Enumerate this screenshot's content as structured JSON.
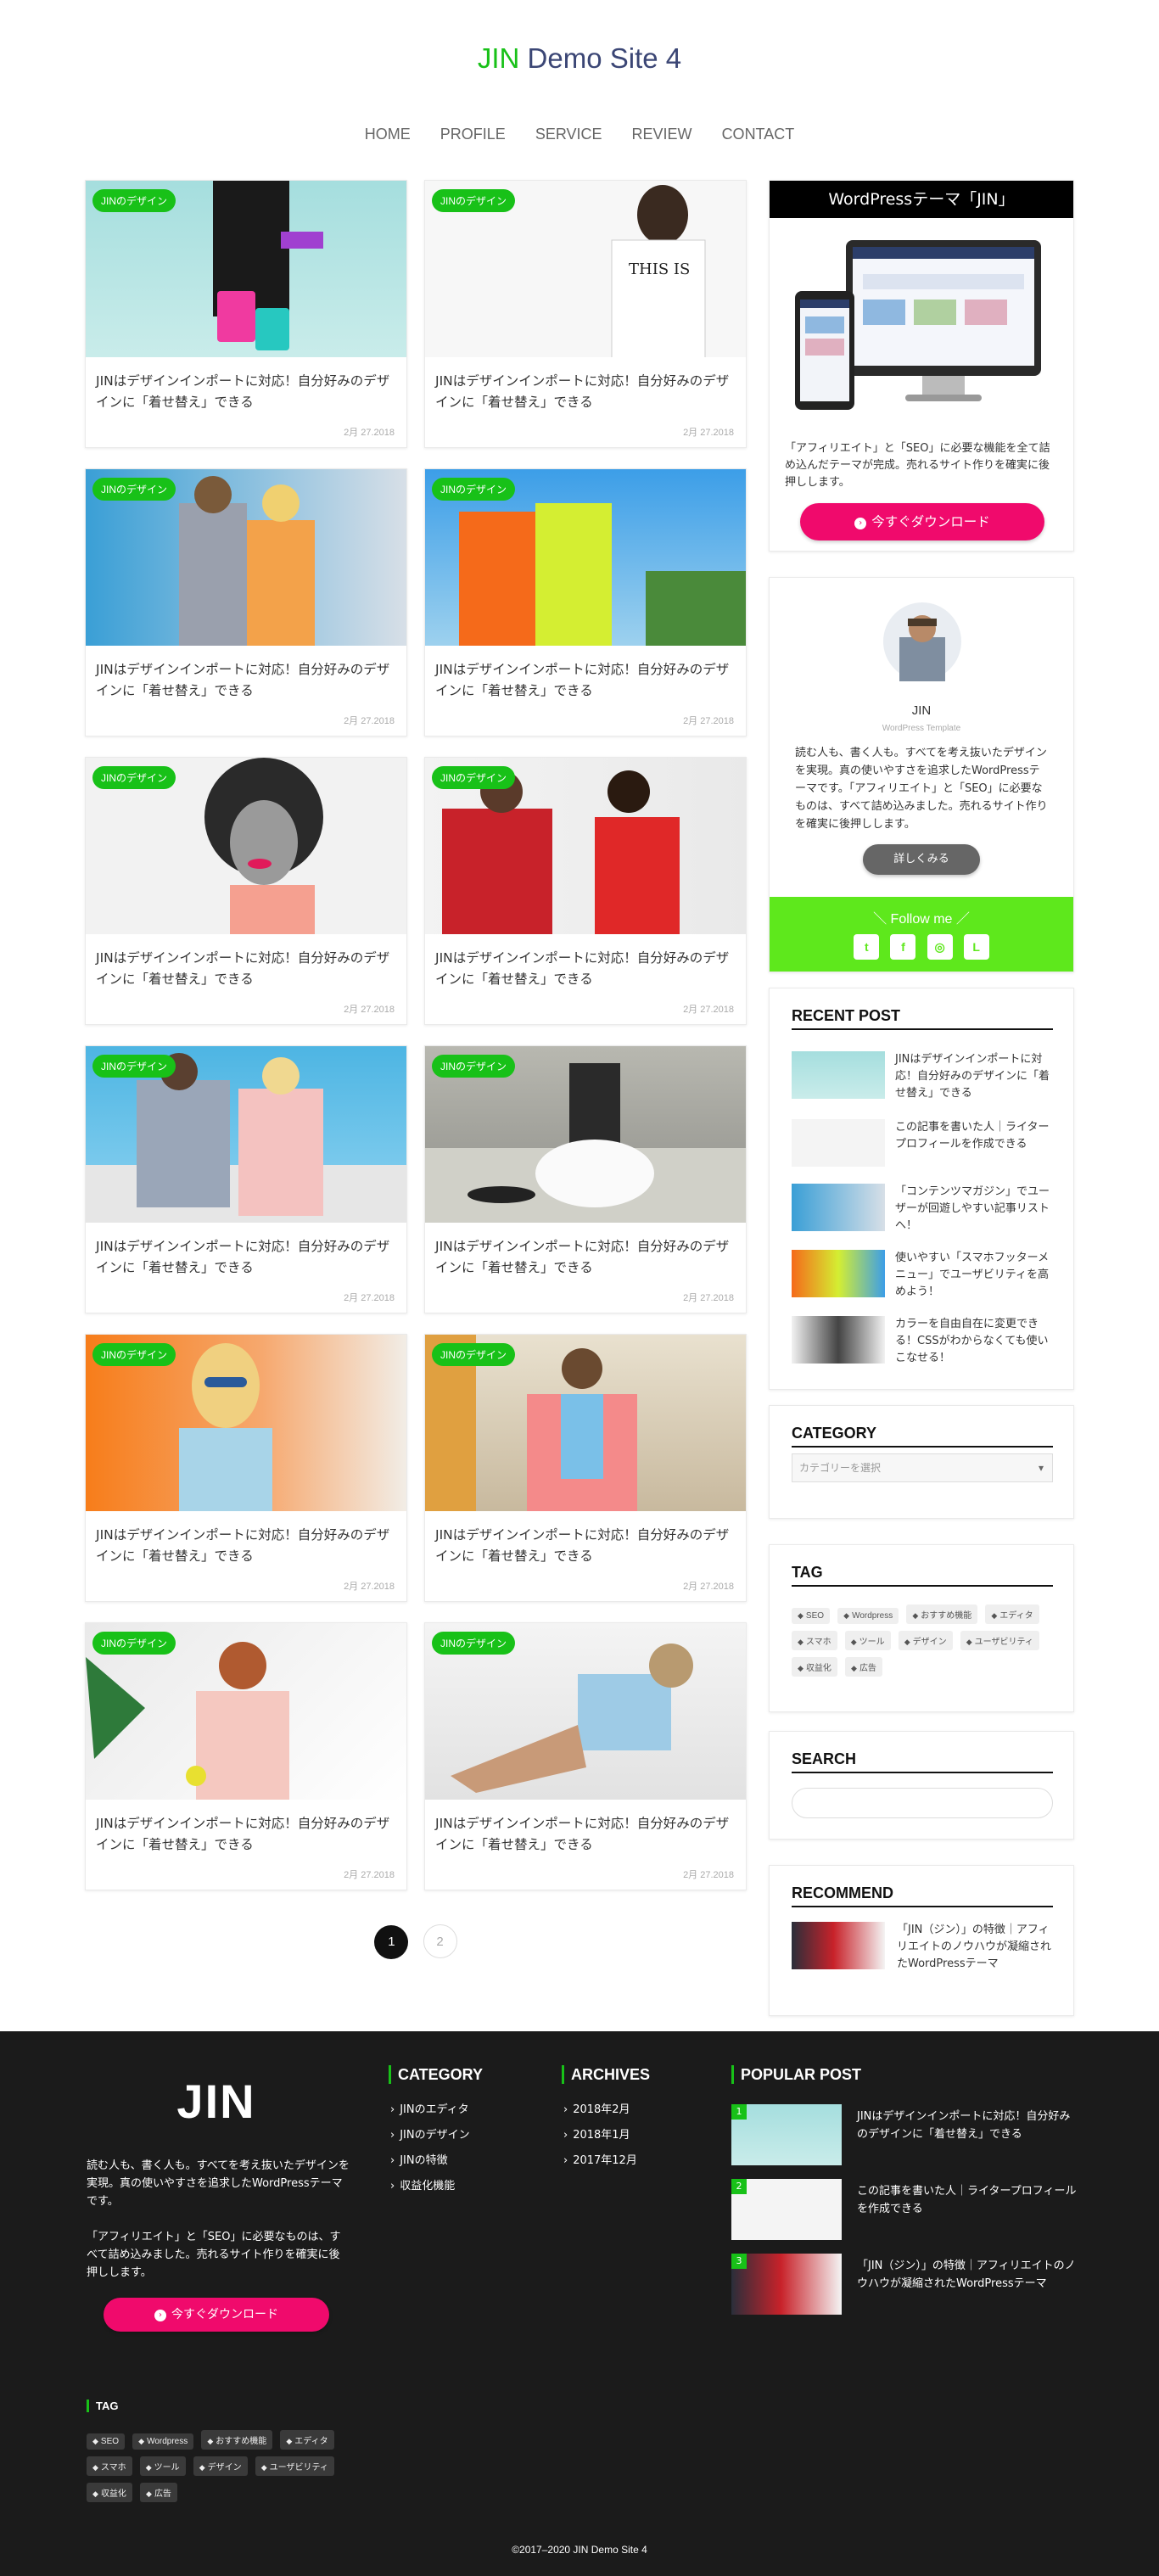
{
  "header": {
    "brand": "JIN",
    "title_rest": " Demo Site 4",
    "nav": [
      "HOME",
      "PROFILE",
      "SERVICE",
      "REVIEW",
      "CONTACT"
    ]
  },
  "posts": [
    {
      "badge": "JINのデザイン",
      "title": "JINはデザインインポートに対応！自分好みのデザインに「着せ替え」できる",
      "date": "2月 27.2018"
    },
    {
      "badge": "JINのデザイン",
      "title": "JINはデザインインポートに対応！自分好みのデザインに「着せ替え」できる",
      "date": "2月 27.2018"
    },
    {
      "badge": "JINのデザイン",
      "title": "JINはデザインインポートに対応！自分好みのデザインに「着せ替え」できる",
      "date": "2月 27.2018"
    },
    {
      "badge": "JINのデザイン",
      "title": "JINはデザインインポートに対応！自分好みのデザインに「着せ替え」できる",
      "date": "2月 27.2018"
    },
    {
      "badge": "JINのデザイン",
      "title": "JINはデザインインポートに対応！自分好みのデザインに「着せ替え」できる",
      "date": "2月 27.2018"
    },
    {
      "badge": "JINのデザイン",
      "title": "JINはデザインインポートに対応！自分好みのデザインに「着せ替え」できる",
      "date": "2月 27.2018"
    },
    {
      "badge": "JINのデザイン",
      "title": "JINはデザインインポートに対応！自分好みのデザインに「着せ替え」できる",
      "date": "2月 27.2018"
    },
    {
      "badge": "JINのデザイン",
      "title": "JINはデザインインポートに対応！自分好みのデザインに「着せ替え」できる",
      "date": "2月 27.2018"
    },
    {
      "badge": "JINのデザイン",
      "title": "JINはデザインインポートに対応！自分好みのデザインに「着せ替え」できる",
      "date": "2月 27.2018"
    },
    {
      "badge": "JINのデザイン",
      "title": "JINはデザインインポートに対応！自分好みのデザインに「着せ替え」できる",
      "date": "2月 27.2018"
    },
    {
      "badge": "JINのデザイン",
      "title": "JINはデザインインポートに対応！自分好みのデザインに「着せ替え」できる",
      "date": "2月 27.2018"
    },
    {
      "badge": "JINのデザイン",
      "title": "JINはデザインインポートに対応！自分好みのデザインに「着せ替え」できる",
      "date": "2月 27.2018"
    }
  ],
  "pagination": {
    "current": "1",
    "next": "2"
  },
  "sidebar": {
    "ad": {
      "title": "WordPressテーマ「JIN」",
      "desc": "「アフィリエイト」と「SEO」に必要な機能を全て詰め込んだテーマが完成。売れるサイト作りを確実に後押しします。",
      "button": "今すぐダウンロード"
    },
    "profile": {
      "name": "JIN",
      "sub": "WordPress Template",
      "desc": "読む人も、書く人も。すべてを考え抜いたデザインを実現。真の使いやすさを追求したWordPressテーマです。「アフィリエイト」と「SEO」に必要なものは、すべて詰め込みました。売れるサイト作りを確実に後押しします。",
      "button": "詳しくみる",
      "follow": "＼ Follow me ／",
      "social": [
        "twitter-icon",
        "facebook-icon",
        "instagram-icon",
        "line-icon"
      ]
    },
    "recent": {
      "heading": "RECENT POST",
      "items": [
        "JINはデザインインポートに対応！自分好みのデザインに「着せ替え」できる",
        "この記事を書いた人｜ライタープロフィールを作成できる",
        "「コンテンツマガジン」でユーザーが回遊しやすい記事リストへ！",
        "使いやすい「スマホフッターメニュー」でユーザビリティを高めよう！",
        "カラーを自由自在に変更できる！CSSがわからなくても使いこなせる！"
      ]
    },
    "category": {
      "heading": "CATEGORY",
      "placeholder": "カテゴリーを選択"
    },
    "tag": {
      "heading": "TAG",
      "items": [
        "SEO",
        "Wordpress",
        "おすすめ機能",
        "エディタ",
        "スマホ",
        "ツール",
        "デザイン",
        "ユーザビリティ",
        "収益化",
        "広告"
      ]
    },
    "search": {
      "heading": "SEARCH"
    },
    "recommend": {
      "heading": "RECOMMEND",
      "title": "「JIN（ジン）」の特徴｜アフィリエイトのノウハウが凝縮されたWordPressテーマ"
    }
  },
  "footer": {
    "logo": "JIN",
    "desc1": "読む人も、書く人も。すべてを考え抜いたデザインを実現。真の使いやすさを追求したWordPressテーマです。",
    "desc2": "「アフィリエイト」と「SEO」に必要なものは、すべて詰め込みました。売れるサイト作りを確実に後押しします。",
    "button": "今すぐダウンロード",
    "category": {
      "heading": "CATEGORY",
      "items": [
        "JINのエディタ",
        "JINのデザイン",
        "JINの特徴",
        "収益化機能"
      ]
    },
    "archives": {
      "heading": "ARCHIVES",
      "items": [
        "2018年2月",
        "2018年1月",
        "2017年12月"
      ]
    },
    "popular": {
      "heading": "POPULAR POST",
      "items": [
        {
          "rank": "1",
          "title": "JINはデザインインポートに対応！自分好みのデザインに「着せ替え」できる"
        },
        {
          "rank": "2",
          "title": "この記事を書いた人｜ライタープロフィールを作成できる"
        },
        {
          "rank": "3",
          "title": "「JIN（ジン）」の特徴｜アフィリエイトのノウハウが凝縮されたWordPressテーマ"
        }
      ]
    },
    "tag": {
      "heading": "TAG",
      "items": [
        "SEO",
        "Wordpress",
        "おすすめ機能",
        "エディタ",
        "スマホ",
        "ツール",
        "デザイン",
        "ユーザビリティ",
        "収益化",
        "広告"
      ]
    },
    "copyright": "©2017–2020 JIN Demo Site 4"
  },
  "colors": {
    "accent": "#18c118",
    "cta": "#f00a6c",
    "follow": "#5ee81c",
    "footer": "#1b1b1b"
  }
}
